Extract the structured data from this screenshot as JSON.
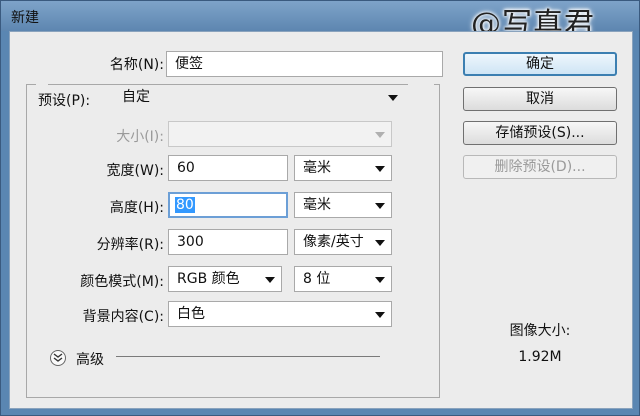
{
  "window": {
    "title": "新建"
  },
  "watermark": "@写真君",
  "form": {
    "name": {
      "label": "名称(N):",
      "value": "便签"
    },
    "preset": {
      "label": "预设(P):",
      "value": "自定"
    },
    "size": {
      "label": "大小(I):",
      "value": ""
    },
    "width": {
      "label": "宽度(W):",
      "value": "60",
      "unit": "毫米"
    },
    "height": {
      "label": "高度(H):",
      "value": "80",
      "unit": "毫米"
    },
    "resolution": {
      "label": "分辨率(R):",
      "value": "300",
      "unit": "像素/英寸"
    },
    "color_mode": {
      "label": "颜色模式(M):",
      "value": "RGB 颜色",
      "depth": "8 位"
    },
    "background": {
      "label": "背景内容(C):",
      "value": "白色"
    },
    "advanced": {
      "label": "高级"
    }
  },
  "buttons": {
    "ok": "确定",
    "cancel": "取消",
    "save_preset": "存储预设(S)...",
    "delete_preset": "删除预设(D)..."
  },
  "info": {
    "image_size_label": "图像大小:",
    "image_size_value": "1.92M"
  }
}
